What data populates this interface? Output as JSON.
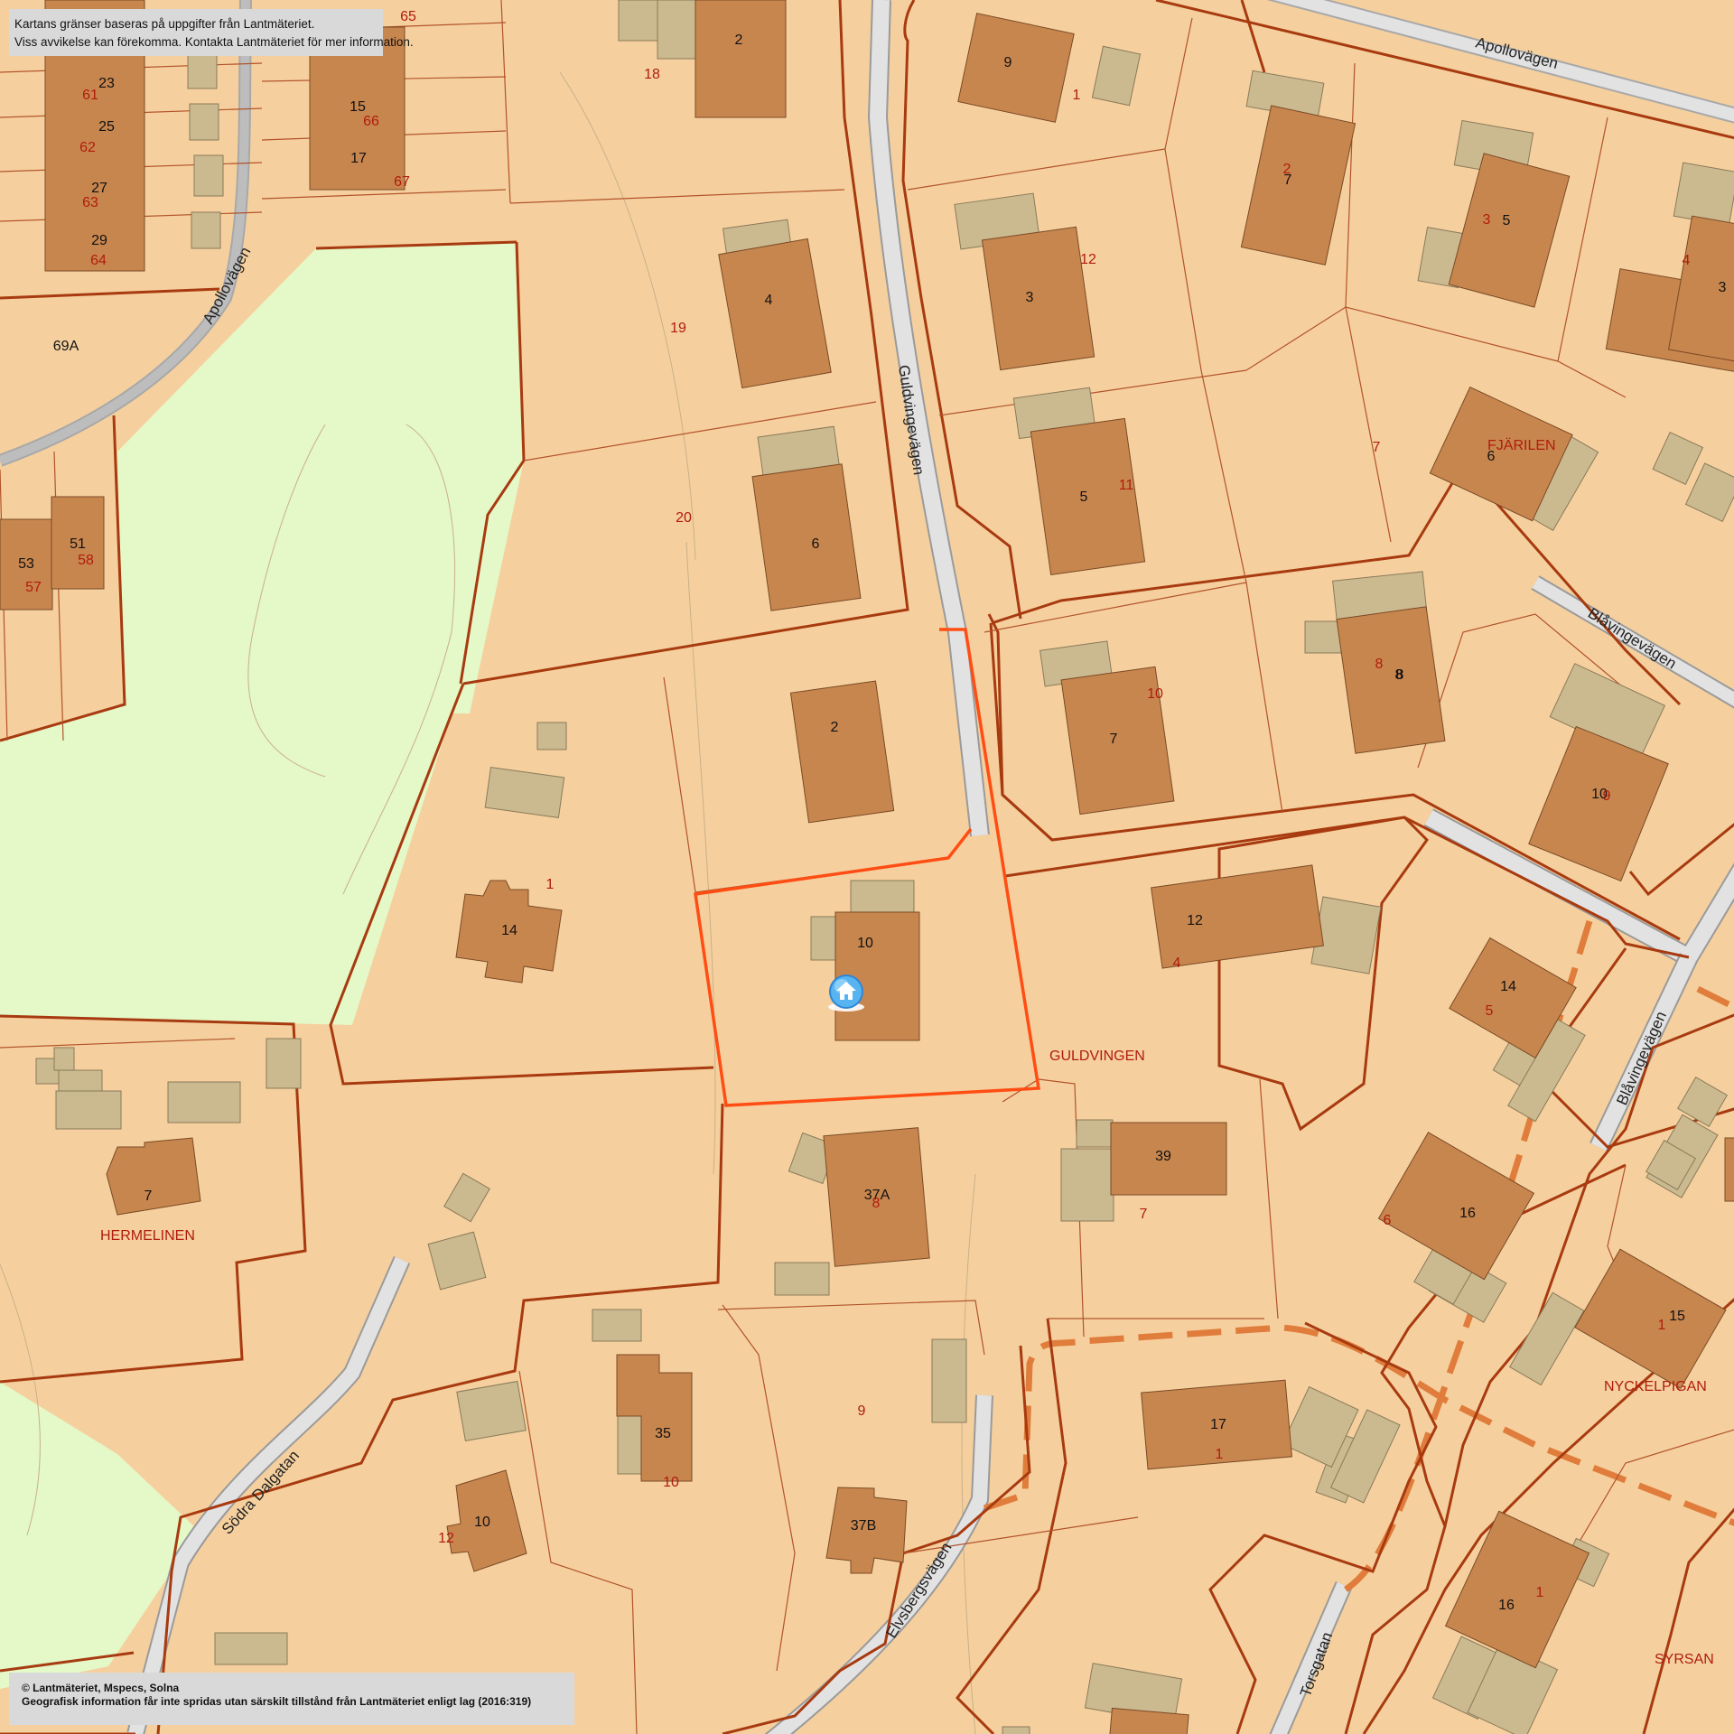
{
  "info_notice": {
    "line1": "Kartans gränser baseras på uppgifter från Lantmäteriet.",
    "line2": "Viss avvikelse kan förekomma. Kontakta Lantmäteriet för mer information."
  },
  "copyright": {
    "line1": "© Lantmäteriet, Mspecs, Solna",
    "line2": "Geografisk information får inte spridas utan särskilt tillstånd från Lantmäteriet enligt lag (2016:319)"
  },
  "roads": {
    "apollovagen_top": "Apollovägen",
    "apollovagen_left": "Apollovägen",
    "guldvingevagen": "Guldvingevägen",
    "blavingevagen_upper": "Blåvingevägen",
    "blavingevagen_lower": "Blåvingevägen",
    "sodra_dalgatan": "Södra Dalgatan",
    "elvsbergsvagen": "Elvsbergsvägen",
    "torsgatan": "Torsgatan"
  },
  "block_names": {
    "fjarilen": "FJÄRILEN",
    "guldvingen": "GULDVINGEN",
    "hermelinen": "HERMELINEN",
    "nyckelpigan": "NYCKELPIGAN",
    "syrsan": "SYRSAN"
  },
  "house_numbers": [
    "23",
    "25",
    "27",
    "29",
    "15",
    "17",
    "2",
    "9",
    "4",
    "6",
    "2",
    "7",
    "5",
    "3",
    "3",
    "5",
    "8",
    "7",
    "10",
    "6",
    "8",
    "14",
    "10",
    "12",
    "14",
    "7",
    "37A",
    "39",
    "16",
    "15",
    "35",
    "10",
    "37B",
    "17",
    "16",
    "53",
    "51",
    "69A"
  ],
  "parcel_numbers": [
    "65",
    "61",
    "62",
    "63",
    "64",
    "66",
    "67",
    "18",
    "1",
    "19",
    "20",
    "2",
    "12",
    "3",
    "4",
    "11",
    "7",
    "10",
    "8",
    "9",
    "1",
    "4",
    "5",
    "7",
    "6",
    "1",
    "8",
    "10",
    "12",
    "9",
    "1",
    "1",
    "57",
    "58"
  ],
  "selected_property": {
    "house_number": "10",
    "marker_icon": "home-icon",
    "highlight_color": "#ff4d14"
  },
  "colors": {
    "parcel_fill": "#f5d09e",
    "building": "#c8864f",
    "outbuilding": "#cbb98f",
    "green_area": "#e4f8c8",
    "road": "#e2e2e2",
    "boundary": "#a83a10",
    "label_red": "#b01c0c"
  }
}
